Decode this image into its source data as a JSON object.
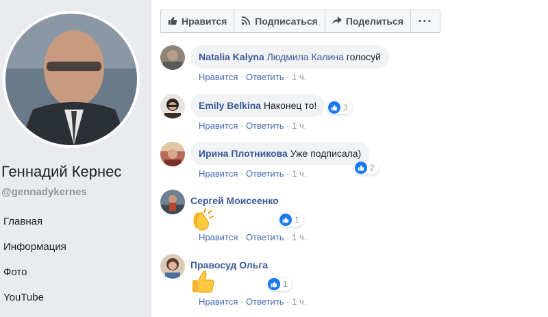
{
  "sidebar": {
    "page_name": "Геннадий Кернес",
    "handle": "@gennadykernes",
    "nav": [
      "Главная",
      "Информация",
      "Фото",
      "YouTube"
    ]
  },
  "actions": {
    "like": "Нравится",
    "subscribe": "Подписаться",
    "share": "Поделиться",
    "more": "···"
  },
  "comments": [
    {
      "author": "Natalia Kalyna",
      "mention": "Людмила Калина",
      "text": "голосуй",
      "like": "Нравится",
      "reply": "Ответить",
      "time": "1 ч.",
      "reactions": null
    },
    {
      "author": "Emily Belkina",
      "mention": "",
      "text": "Наконец то!",
      "like": "Нравится",
      "reply": "Ответить",
      "time": "1 ч.",
      "reactions": "3"
    },
    {
      "author": "Ирина Плотникова",
      "mention": "",
      "text": "Уже подписала)",
      "like": "Нравится",
      "reply": "Ответить",
      "time": "1 ч.",
      "reactions": "2"
    },
    {
      "author": "Сергей Моисеенко",
      "mention": "",
      "text": "",
      "like": "Нравится",
      "reply": "Ответить",
      "time": "1 ч.",
      "reactions": "1",
      "sticker": "clapping-hands-emoji"
    },
    {
      "author": "Правосуд Ольга",
      "mention": "",
      "text": "",
      "like": "Нравится",
      "reply": "Ответить",
      "time": "1 ч.",
      "reactions": "1",
      "sticker": "thumbs-up-emoji"
    }
  ],
  "separator": "·",
  "colors": {
    "link": "#385898",
    "meta": "#90949c",
    "like_blue": "#1877f2",
    "sidebar_bg": "#e9ebee"
  }
}
